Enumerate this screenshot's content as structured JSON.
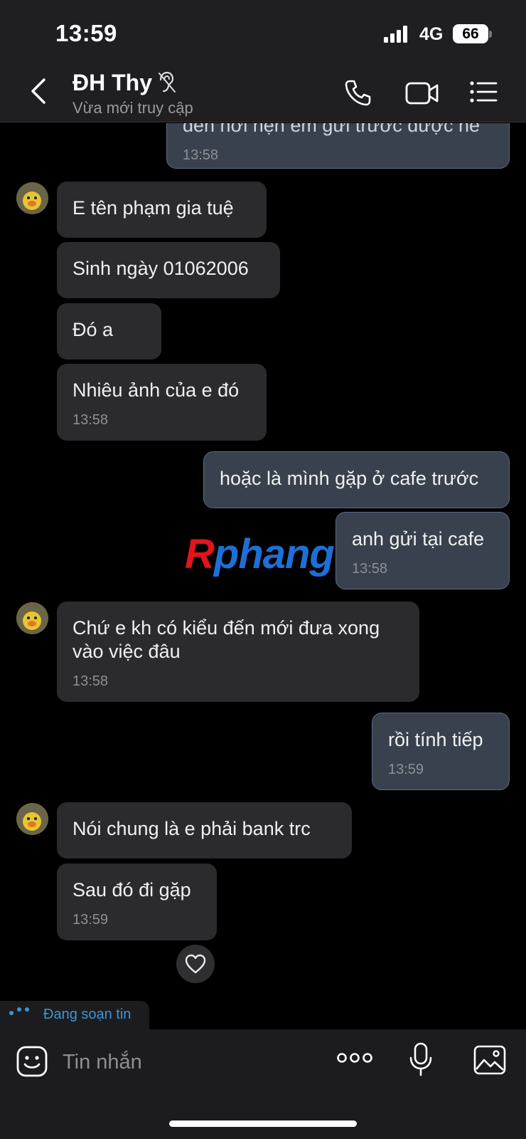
{
  "status_bar": {
    "time": "13:59",
    "network": "4G",
    "battery": "66"
  },
  "header": {
    "contact_name": "ĐH Thy",
    "contact_status": "Vừa mới truy cập"
  },
  "messages": [
    {
      "direction": "out",
      "text": "đến nơi hẹn em gửi trước được ne",
      "time": "13:58",
      "partial": true
    },
    {
      "direction": "in",
      "text": "E tên phạm gia tuệ"
    },
    {
      "direction": "in",
      "text": "Sinh ngày 01062006"
    },
    {
      "direction": "in",
      "text": "Đó a"
    },
    {
      "direction": "in",
      "text": "Nhiêu ảnh của e đó",
      "time": "13:58"
    },
    {
      "direction": "out",
      "text": "hoặc là mình gặp ở cafe trước"
    },
    {
      "direction": "out",
      "text": "anh gửi tại cafe",
      "time": "13:58"
    },
    {
      "direction": "in",
      "text": "Chứ e kh có kiểu đến mới đưa xong vào việc đâu",
      "time": "13:58"
    },
    {
      "direction": "out",
      "text": "rồi tính tiếp",
      "time": "13:59"
    },
    {
      "direction": "in",
      "text": "Nói chung là e phải bank trc"
    },
    {
      "direction": "in",
      "text": "Sau đó đi gặp",
      "time": "13:59",
      "reaction": "heart"
    }
  ],
  "watermark": {
    "first": "R",
    "rest": "phang"
  },
  "typing_indicator": "Đang soạn tin",
  "input": {
    "placeholder": "Tin nhắn"
  },
  "icons": {
    "back": "back-chevron-icon",
    "call": "phone-icon",
    "video": "video-camera-icon",
    "menu": "list-menu-icon",
    "emoji": "emoji-sticker-icon",
    "more": "more-dots-icon",
    "mic": "microphone-icon",
    "image": "image-gallery-icon",
    "reaction": "heart-icon"
  },
  "colors": {
    "incoming_bubble": "#2b2b2d",
    "outgoing_bubble": "#39414f",
    "typing_accent": "#3c95d6",
    "background": "#000000"
  }
}
